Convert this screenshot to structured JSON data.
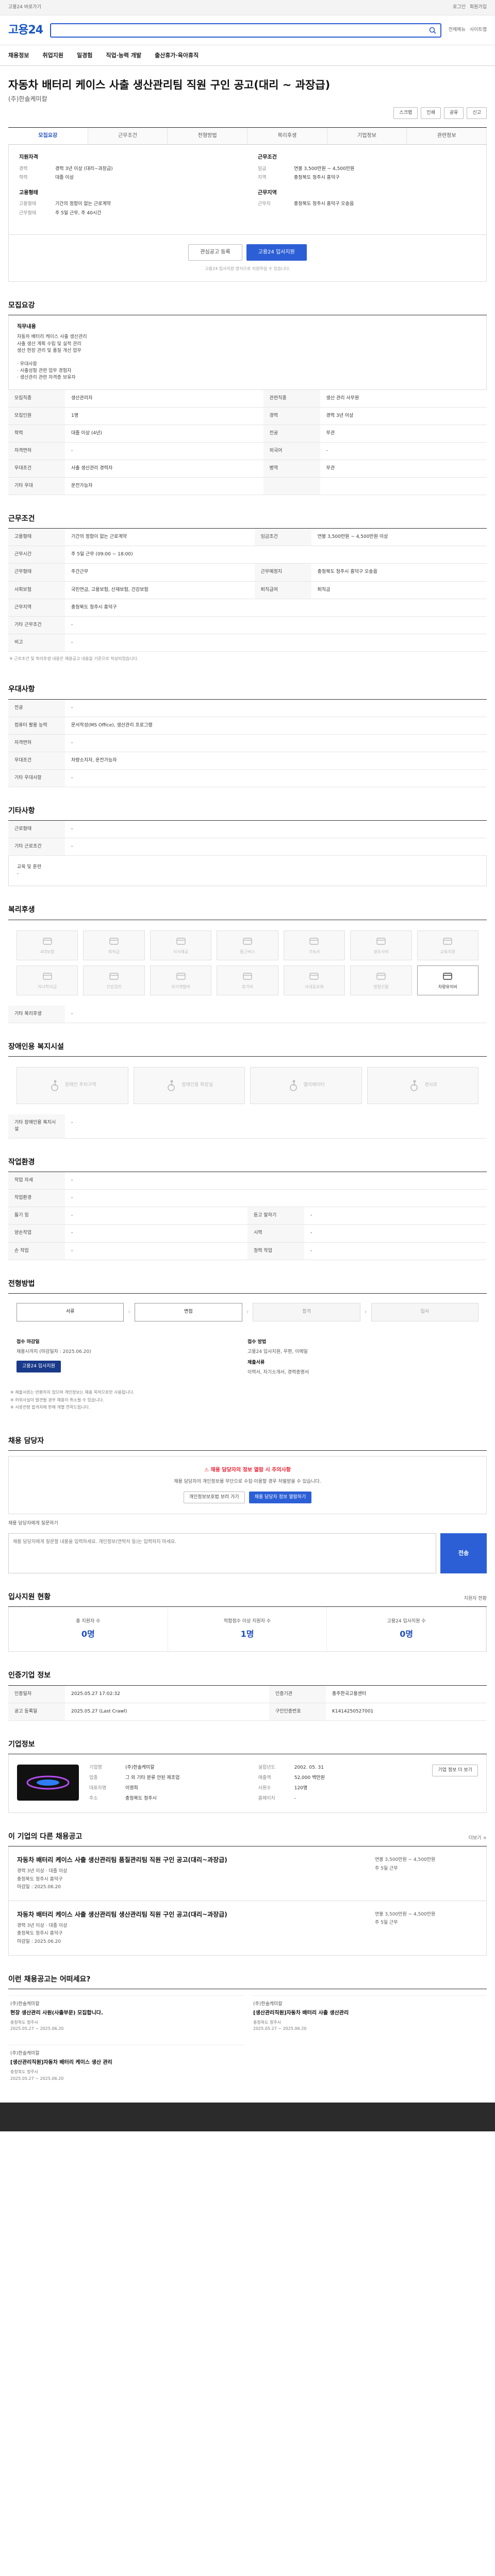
{
  "topbar": {
    "links": [
      "고용24 바로가기",
      "로그인",
      "회원가입"
    ]
  },
  "header": {
    "logo": "고용24",
    "logo_sub": "",
    "util": [
      "전체메뉴",
      "사이트맵"
    ]
  },
  "gnb": {
    "items": [
      "채용정보",
      "취업지원",
      "일경험",
      "직업·능력 개발",
      "출산휴가·육아휴직"
    ],
    "right": [
      "취업정보",
      "채용정보"
    ]
  },
  "title": {
    "main": "자동차 배터리 케이스 사출 생산관리팀 직원 구인 공고(대리 ~ 과장급)",
    "company": "(주)한솔케미칼",
    "buttons": [
      "스크랩",
      "인쇄",
      "공유",
      "신고"
    ]
  },
  "tabs": [
    "모집요강",
    "근무조건",
    "전형방법",
    "복리후생",
    "기업정보",
    "관련정보"
  ],
  "summary": {
    "left_group_title": "지원자격",
    "left_rows": [
      {
        "k": "경력",
        "v": "경력 3년 이상 (대리~과장급)"
      },
      {
        "k": "학력",
        "v": "대졸 이상"
      }
    ],
    "left2_title": "고용형태",
    "left2_rows": [
      {
        "k": "고용형태",
        "v": "기간의 정함이 없는 근로계약"
      },
      {
        "k": "근무형태",
        "v": "주 5일 근무, 주 40시간"
      }
    ],
    "right_group_title": "근무조건",
    "right_rows": [
      {
        "k": "임금",
        "v": "연봉 3,500만원 ~ 4,500만원"
      },
      {
        "k": "지역",
        "v": "충청북도 청주시 흥덕구"
      }
    ],
    "right2_title": "근무지역",
    "right2_rows": [
      {
        "k": "근무지",
        "v": "충청북도 청주시 흥덕구 오송읍"
      }
    ]
  },
  "apply": {
    "btn1": "관심공고 등록",
    "btn2": "고용24 입사지원",
    "note": "고용24 입사지원 방식으로 지원하실 수 있습니다."
  },
  "recruit": {
    "title": "모집요강",
    "para_title": "직무내용",
    "para_body": "자동차 배터리 케이스 사출 생산관리\n사출 생산 계획 수립 및 실적 관리\n생산 현장 관리 및 품질 개선 업무\n\n· 우대사항\n· 사출성형 관련 업무 경험자\n· 생산관리 관련 자격증 보유자",
    "rows": [
      {
        "k": "모집직종",
        "v": "생산관리자",
        "k2": "관련직종",
        "v2": "생산 관리 사무원"
      },
      {
        "k": "모집인원",
        "v": "1명",
        "k2": "경력",
        "v2": "경력 3년 이상"
      },
      {
        "k": "학력",
        "v": "대졸 이상 (4년)",
        "k2": "전공",
        "v2": "무관"
      },
      {
        "k": "자격면허",
        "v": "-",
        "k2": "외국어",
        "v2": "-"
      },
      {
        "k": "우대조건",
        "v": "사출 생산관리 경력자",
        "k2": "병역",
        "v2": "무관"
      },
      {
        "k": "기타 우대",
        "v": "운전가능자",
        "k2": "",
        "v2": ""
      }
    ]
  },
  "conditions": {
    "title": "근무조건",
    "rows": [
      {
        "k": "고용형태",
        "v": "기간의 정함이 없는 근로계약",
        "k2": "임금조건",
        "v2": "연봉 3,500만원 ~ 4,500만원 이상"
      },
      {
        "k": "근무시간",
        "v": "주 5일 근무 (09:00 ~ 18:00)",
        "k2": "",
        "v2": ""
      },
      {
        "k": "근무형태",
        "v": "주간근무",
        "k2": "근무예정지",
        "v2": "충청북도 청주시 흥덕구 오송읍"
      },
      {
        "k": "사회보험",
        "v": "국민연금, 고용보험, 산재보험, 건강보험",
        "k2": "퇴직급여",
        "v2": "퇴직금"
      },
      {
        "k": "근무지역",
        "v": "충청북도 청주시 흥덕구",
        "k2": "",
        "v2": ""
      },
      {
        "k": "기타 근무조건",
        "v": "-",
        "k2": "",
        "v2": ""
      },
      {
        "k": "비고",
        "v": "-",
        "k2": "",
        "v2": ""
      }
    ],
    "note": "※ 근로조건 및 복리후생 내용은 채용공고 내용을 기준으로 작성되었습니다."
  },
  "company_info": {
    "title": "우대사항",
    "rows": [
      {
        "k": "전공",
        "v": "-"
      },
      {
        "k": "컴퓨터 활용 능력",
        "v": "문서작성(MS Office), 생산관리 프로그램"
      },
      {
        "k": "자격면허",
        "v": "-"
      },
      {
        "k": "우대조건",
        "v": "차량소지자, 운전가능자"
      },
      {
        "k": "기타 우대사항",
        "v": "-"
      }
    ]
  },
  "extra": {
    "title": "기타사항",
    "rows": [
      {
        "k": "근로형태",
        "v": "-"
      },
      {
        "k": "기타 근로조건",
        "v": "-"
      }
    ],
    "note": "교육 및 훈련\n-"
  },
  "welfare": {
    "title": "복리후생",
    "items": [
      "4대보험",
      "퇴직금",
      "식사제공",
      "통근버스",
      "기숙사",
      "경조사비",
      "교육지원",
      "자녀학자금",
      "건강검진",
      "자기계발비",
      "휴가비",
      "사내동호회",
      "명절선물",
      "차량유지비"
    ],
    "active": [
      13
    ],
    "extra_title": "기타 복리후생",
    "extra_value": "-"
  },
  "accessibility": {
    "title": "장애인용 복지시설",
    "items": [
      "장애인 주차구역",
      "장애인용 화장실",
      "엘리베이터",
      "경사로"
    ],
    "extra_title": "기타 장애인용 복지시설",
    "extra_value": "-"
  },
  "environment": {
    "title": "작업환경",
    "rows": [
      {
        "k": "작업 자세",
        "v": "-",
        "k2": "",
        "v2": ""
      },
      {
        "k": "작업환경",
        "v": "-",
        "k2": "",
        "v2": ""
      },
      {
        "k": "들기 힘",
        "v": "-",
        "k2": "듣고 말하기",
        "v2": "-"
      },
      {
        "k": "양손작업",
        "v": "-",
        "k2": "시력",
        "v2": "-"
      },
      {
        "k": "손 작업",
        "v": "-",
        "k2": "청력 작업",
        "v2": "-"
      }
    ]
  },
  "process": {
    "title": "전형방법",
    "steps": [
      "서류",
      "면접",
      "합격",
      "입사"
    ],
    "active": [
      0,
      1
    ],
    "method_title": "접수 마감일",
    "method_value": "채용시까지 (마감일자 : 2025.06.20)",
    "method2_title": "접수 방법",
    "method2_value": "고용24 입사지원, 우편, 이메일",
    "method3_title": "제출서류",
    "method3_value": "이력서, 자기소개서, 경력증명서",
    "apply_btn": "고용24 입사지원",
    "notices": [
      "※ 제출서류는 반환하지 않으며 개인정보는 채용 목적으로만 사용됩니다.",
      "※ 허위사실이 발견될 경우 채용이 취소될 수 있습니다.",
      "※ 서류전형 합격자에 한해 개별 연락드립니다."
    ]
  },
  "report": {
    "title": "채용 담당자",
    "alert": "채용 담당자의 정보 열람 시 주의사항",
    "body": "채용 담당자의 개인정보를 무단으로 수집·이용할 경우 처벌받을 수 있습니다.",
    "btn1": "개인정보보호법 보러 가기",
    "btn2": "채용 담당자 정보 열람하기",
    "qna_label": "채용 담당자에게 질문하기",
    "qna_placeholder": "채용 담당자에게 질문할 내용을 입력하세요. 개인정보(연락처 등)는 입력하지 마세요.",
    "send": "전송"
  },
  "stats": {
    "title": "입사지원 현황",
    "sub": "지원자 현황",
    "items": [
      {
        "lbl": "총 지원자 수",
        "num": "0명"
      },
      {
        "lbl": "적합점수 이상 지원자 수",
        "num": "1명"
      },
      {
        "lbl": "고용24 입사지원 수",
        "num": "0명"
      }
    ]
  },
  "manager": {
    "title": "인증기업 정보",
    "rows": [
      {
        "k": "인증일자",
        "v": "2025.05.27 17:02:32",
        "k2": "인증기관",
        "v2": "충주한국고용센터"
      },
      {
        "k": "공고 등록일",
        "v": "2025.05.27 (Last Crawl)",
        "k2": "구인인증번호",
        "v2": "K1414250527001"
      }
    ]
  },
  "company": {
    "title": "기업정보",
    "rows": [
      {
        "k": "기업명",
        "v": "(주)한솔케미칼",
        "k2": "설립년도",
        "v2": "2002. 05. 31"
      },
      {
        "k": "업종",
        "v": "그 외 기타 분류 안된 제조업",
        "k2": "매출액",
        "v2": "52,000 백만원"
      },
      {
        "k": "대표자명",
        "v": "이영희",
        "k2": "사원수",
        "v2": "120명"
      },
      {
        "k": "주소",
        "v": "충청북도 청주시",
        "k2": "홈페이지",
        "v2": "-"
      }
    ],
    "btn": "기업 정보 더 보기"
  },
  "related": {
    "title": "이 기업의 다른 채용공고",
    "more": "더보기 +",
    "jobs": [
      {
        "title": "자동차 배터리 케이스 사출 생산관리팀 품질관리팀 직원 구인 공고(대리~과장급)",
        "meta": "경력 3년 이상 · 대졸 이상\n충청북도 청주시 흥덕구\n마감일 : 2025.06.20",
        "side": "연봉 3,500만원 ~ 4,500만원\n주 5일 근무"
      },
      {
        "title": "자동차 배터리 케이스 사출 생산관리팀 생산관리팀 직원 구인 공고(대리~과장급)",
        "meta": "경력 3년 이상 · 대졸 이상\n충청북도 청주시 흥덕구\n마감일 : 2025.06.20",
        "side": "연봉 3,500만원 ~ 4,500만원\n주 5일 근무"
      }
    ]
  },
  "recommend": {
    "title": "이런 채용공고는 어떠세요?",
    "items": [
      {
        "c": "(주)한솔케미칼",
        "t": "현장 생산관리 사원(사출부문) 모집합니다.",
        "m": "충청북도 청주시\n2025.05.27 ~ 2025.06.20"
      },
      {
        "c": "(주)한솔케미칼",
        "t": "[생산관리직원]자동차 배터리 사출 생산관리",
        "m": "충청북도 청주시\n2025.05.27 ~ 2025.06.20"
      },
      {
        "c": "(주)한솔케미칼",
        "t": "[생산관리직원]자동차 배터리 케이스 생산 관리",
        "m": "충청북도 청주시\n2025.05.27 ~ 2025.06.20"
      }
    ]
  }
}
